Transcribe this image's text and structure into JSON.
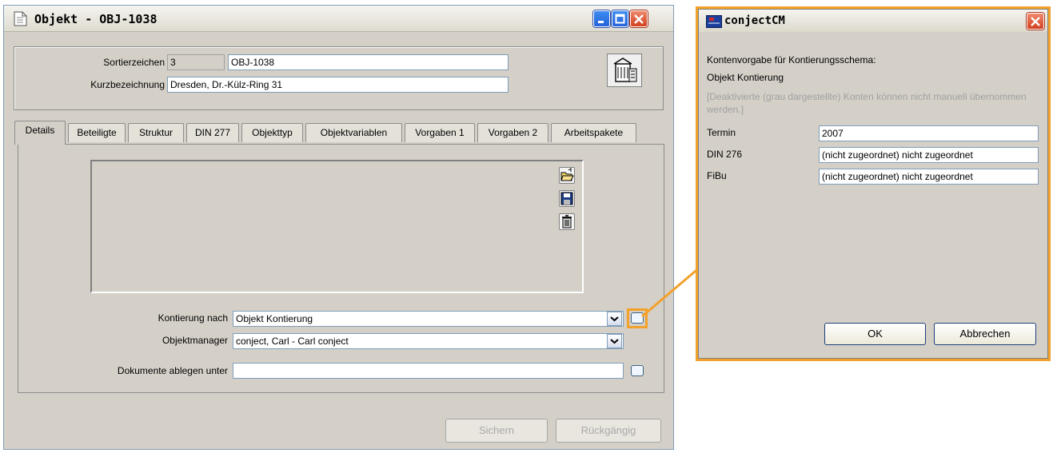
{
  "main": {
    "title": "Objekt - OBJ-1038",
    "sortier_label": "Sortierzeichen",
    "sortier_value": "3",
    "obj_value": "OBJ-1038",
    "kurz_label": "Kurzbezeichnung",
    "kurz_value": "Dresden, Dr.-Külz-Ring 31",
    "tabs": [
      "Details",
      "Beteiligte",
      "Struktur",
      "DIN 277",
      "Objekttyp",
      "Objektvariablen",
      "Vorgaben 1",
      "Vorgaben 2",
      "Arbeitspakete"
    ],
    "kontierung_label": "Kontierung nach",
    "kontierung_value": "Objekt Kontierung",
    "objektmanager_label": "Objektmanager",
    "objektmanager_value": "conject, Carl  -  Carl conject",
    "dokumente_label": "Dokumente ablegen unter",
    "dokumente_value": "",
    "save_label": "Sichern",
    "undo_label": "Rückgängig"
  },
  "dialog": {
    "title": "conjectCM",
    "heading": "Kontenvorgabe für Kontierungsschema:",
    "schema": "Objekt Kontierung",
    "note": "[Deaktivierte (grau dargestellte) Konten können nicht manuell übernommen werden.]",
    "rows": [
      {
        "label": "Termin",
        "value": "2007"
      },
      {
        "label": "DIN 276",
        "value": "(nicht zugeordnet)   nicht zugeordnet"
      },
      {
        "label": "FiBu",
        "value": "(nicht zugeordnet)   nicht zugeordnet"
      }
    ],
    "ok_label": "OK",
    "cancel_label": "Abbrechen"
  },
  "colors": {
    "highlight": "#f2a12b",
    "window_bg": "#d4d0c8",
    "close_button": "#d2401f",
    "title_button": "#2663d8"
  },
  "icons": [
    "document-icon",
    "minimize-icon",
    "maximize-icon",
    "close-icon",
    "building-icon",
    "folder-open-icon",
    "save-icon",
    "trash-icon",
    "chevron-down-icon",
    "app-icon"
  ]
}
